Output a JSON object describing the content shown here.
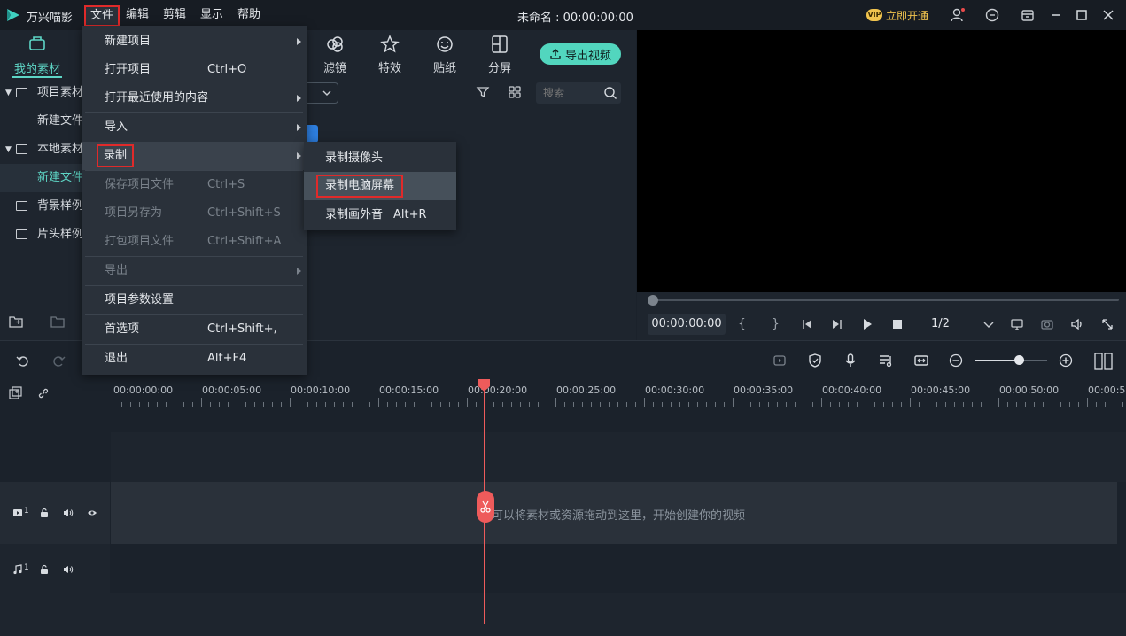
{
  "app": {
    "name": "万兴喵影",
    "document_title": "未命名 : 00:00:00:00",
    "vip_label": "立即开通",
    "vip_badge": "VIP"
  },
  "menubar": {
    "file": "文件",
    "edit": "编辑",
    "clip": "剪辑",
    "view": "显示",
    "help": "帮助"
  },
  "left_panel": {
    "tab_label": "我的素材",
    "tree": [
      {
        "label": "项目素材",
        "expanded": true
      },
      {
        "label": "新建文件"
      },
      {
        "label": "本地素材",
        "expanded": true
      },
      {
        "label": "新建文件",
        "selected": true
      },
      {
        "label": "背景样例"
      },
      {
        "label": "片头样例"
      }
    ]
  },
  "toolbar_tabs": {
    "filter": "滤镜",
    "effects": "特效",
    "stickers": "贴纸",
    "split": "分屏",
    "export": "导出视频"
  },
  "search": {
    "placeholder": "搜索"
  },
  "preview": {
    "timecode": "00:00:00:00",
    "ratio": "1/2",
    "progress": 0
  },
  "timeline": {
    "ruler_labels": [
      "00:00:00:00",
      "00:00:05:00",
      "00:00:10:00",
      "00:00:15:00",
      "00:00:20:00",
      "00:00:25:00",
      "00:00:30:00",
      "00:00:35:00",
      "00:00:40:00",
      "00:00:45:00",
      "00:00:50:00",
      "00:00:5"
    ],
    "drop_hint": "可以将素材或资源拖动到这里，开始创建你的视频",
    "video_track_num": "1",
    "audio_track_num": "1",
    "zoom_level": 0.6
  },
  "file_menu": {
    "items": [
      {
        "label": "新建项目",
        "submenu": true
      },
      {
        "label": "打开项目",
        "shortcut": "Ctrl+O"
      },
      {
        "label": "打开最近使用的内容",
        "submenu": true
      },
      {
        "label": "导入",
        "submenu": true
      },
      {
        "label": "录制",
        "submenu": true,
        "highlighted": true
      },
      {
        "label": "保存项目文件",
        "shortcut": "Ctrl+S",
        "disabled": true
      },
      {
        "label": "项目另存为",
        "shortcut": "Ctrl+Shift+S",
        "disabled": true
      },
      {
        "label": "打包项目文件",
        "shortcut": "Ctrl+Shift+A",
        "disabled": true
      },
      {
        "label": "导出",
        "submenu": true,
        "disabled": true
      },
      {
        "label": "项目参数设置"
      },
      {
        "label": "首选项",
        "shortcut": "Ctrl+Shift+,"
      },
      {
        "label": "退出",
        "shortcut": "Alt+F4"
      }
    ]
  },
  "record_submenu": {
    "items": [
      {
        "label": "录制摄像头"
      },
      {
        "label": "录制电脑屏幕",
        "highlighted": true
      },
      {
        "label": "录制画外音",
        "shortcut": "Alt+R"
      }
    ]
  },
  "colors": {
    "accent": "#5ed6c6",
    "export_button": "#52d6be",
    "playhead": "#ee5b5b",
    "highlight_border": "#e02a2a",
    "vip": "#f1c44e"
  }
}
